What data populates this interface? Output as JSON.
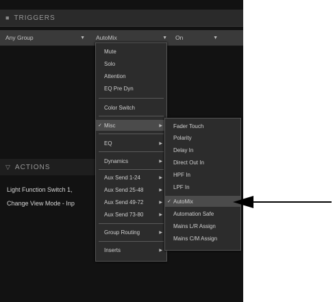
{
  "triggers": {
    "title": "TRIGGERS"
  },
  "filter": {
    "group": "Any Group",
    "item": "AutoMix",
    "state": "On"
  },
  "actions": {
    "title": "ACTIONS",
    "rows": [
      "Light Function Switch 1,",
      "Change View Mode - Inp"
    ]
  },
  "menu1": {
    "items": [
      "Mute",
      "Solo",
      "Attention",
      "EQ Pre Dyn",
      "Color Switch",
      "Misc",
      "EQ",
      "Dynamics",
      "Aux Send 1-24",
      "Aux Send 25-48",
      "Aux Send 49-72",
      "Aux Send 73-80",
      "Group Routing",
      "Inserts"
    ]
  },
  "menu2": {
    "items": [
      "Fader Touch",
      "Polarity",
      "Delay In",
      "Direct Out In",
      "HPF In",
      "LPF In",
      "AutoMix",
      "Automation Safe",
      "Mains L/R Assign",
      "Mains C/M Assign"
    ]
  },
  "icons": {
    "submenu": "chevron-right-icon",
    "check": "checkmark-icon",
    "pointer": "arrow-left-icon"
  },
  "colors": {
    "app_bg": "#121212",
    "menu_bg": "#2c2c2c",
    "highlight": "#4b4b4b",
    "text": "#d0d0d0"
  }
}
